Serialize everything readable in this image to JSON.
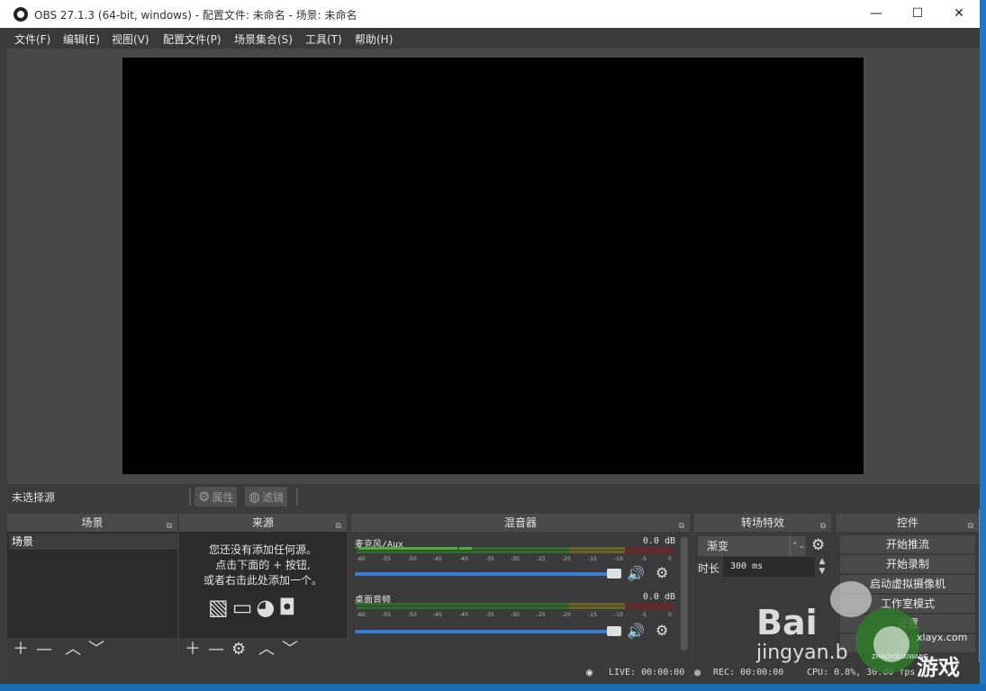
{
  "window": {
    "title": "OBS 27.1.3 (64-bit, windows) - 配置文件: 未命名 - 场景: 未命名",
    "minimize": "—",
    "maximize": "☐",
    "close": "✕"
  },
  "menu": {
    "items": [
      "文件(F)",
      "编辑(E)",
      "视图(V)",
      "配置文件(P)",
      "场景集合(S)",
      "工具(T)",
      "帮助(H)"
    ]
  },
  "context_bar": {
    "no_source": "未选择源",
    "properties": "属性",
    "filters": "滤镜"
  },
  "scenes": {
    "title": "场景",
    "items": [
      "场景"
    ]
  },
  "sources": {
    "title": "来源",
    "empty_line1": "您还没有添加任何源。",
    "empty_line2": "点击下面的 + 按钮,",
    "empty_line3": "或者右击此处添加一个。"
  },
  "mixer": {
    "title": "混音器",
    "channels": [
      {
        "name": "麦克风/Aux",
        "db": "0.0 dB",
        "volume": 1.0
      },
      {
        "name": "桌面音频",
        "db": "0.0 dB",
        "volume": 1.0
      }
    ],
    "ticks": [
      "-60",
      "-55",
      "-50",
      "-45",
      "-40",
      "-35",
      "-30",
      "-25",
      "-20",
      "-15",
      "-10",
      "-5",
      "0"
    ]
  },
  "transitions": {
    "title": "转场特效",
    "selected": "渐变",
    "duration_label": "时长",
    "duration_value": "300 ms"
  },
  "controls": {
    "title": "控件",
    "buttons": [
      "开始推流",
      "开始录制",
      "启动虚拟摄像机",
      "工作室模式",
      "设置",
      "退出"
    ]
  },
  "status": {
    "live": "LIVE: 00:00:00",
    "rec": "REC: 00:00:00",
    "cpu": "CPU: 0.8%, 30.00 fps"
  },
  "watermark": {
    "baidu": "Bai",
    "jingyan": "jingyan.b",
    "site": "xlayx.com",
    "youxi": "游戏",
    "tiny": "ZHAOYOUXIWANG"
  },
  "colors": {
    "accent": "#3d7dd3",
    "meter_green": "#4caf3a",
    "meter_yellow": "#b0a43a",
    "meter_red": "#b23a3a"
  }
}
